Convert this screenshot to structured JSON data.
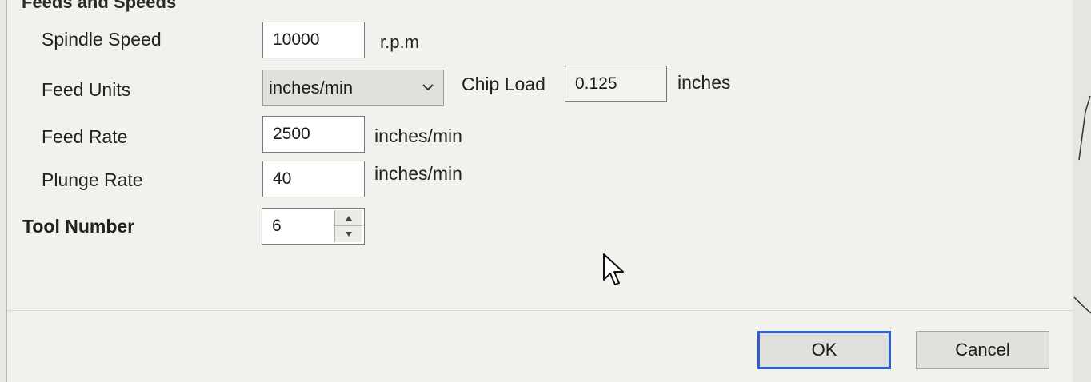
{
  "section": {
    "title": "Feeds and Speeds"
  },
  "spindle_speed": {
    "label": "Spindle Speed",
    "value": "10000",
    "unit": "r.p.m"
  },
  "feed_units": {
    "label": "Feed Units",
    "selected": "inches/min"
  },
  "chip_load": {
    "label": "Chip Load",
    "value": "0.125",
    "unit": "inches"
  },
  "feed_rate": {
    "label": "Feed Rate",
    "value": "2500",
    "unit": "inches/min"
  },
  "plunge_rate": {
    "label": "Plunge Rate",
    "value": "40",
    "unit": "inches/min"
  },
  "tool_number": {
    "label": "Tool Number",
    "value": "6"
  },
  "buttons": {
    "ok": "OK",
    "cancel": "Cancel"
  },
  "colors": {
    "default_button_border": "#2c5fcf",
    "dialog_bg": "#f2f1ed"
  }
}
